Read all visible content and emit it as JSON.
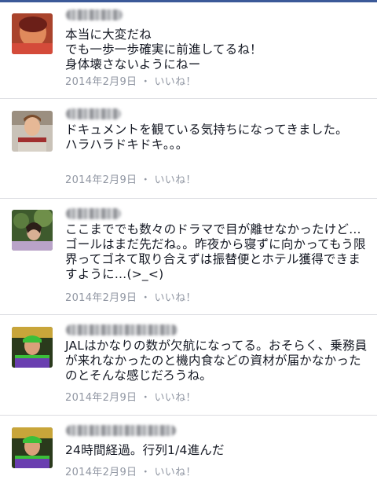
{
  "comments": [
    {
      "text": "本当に大変だね\nでも一歩一歩確実に前進してるね！\n身体壊さないようにねー",
      "date": "2014年2月9日",
      "sep": " ・ ",
      "like": "いいね！"
    },
    {
      "text": "ドキュメントを観ている気持ちになってきました。\nハラハラドキドキ。。。",
      "date": "2014年2月9日",
      "sep": " ・ ",
      "like": "いいね！"
    },
    {
      "text": "ここまででも数々のドラマで目が離せなかったけど…ゴールはまだ先だね。。昨夜から寝ずに向かってもう限界ってゴネて取り合えずは振替便とホテル獲得できますように…(>_<)",
      "date": "2014年2月9日",
      "sep": " ・ ",
      "like": "いいね！"
    },
    {
      "text": "JALはかなりの数が欠航になってる。おそらく、乗務員が来れなかったのと機内食などの資材が届かなかったのとそんな感じだろうね。",
      "date": "2014年2月9日",
      "sep": " ・ ",
      "like": "いいね！"
    },
    {
      "text": "24時間経過。行列1/4進んだ",
      "date": "2014年2月9日",
      "sep": " ・ ",
      "like": "いいね！"
    }
  ],
  "colors": {
    "text": "#141823",
    "meta": "#9197a3",
    "divider": "#dcdde2"
  }
}
